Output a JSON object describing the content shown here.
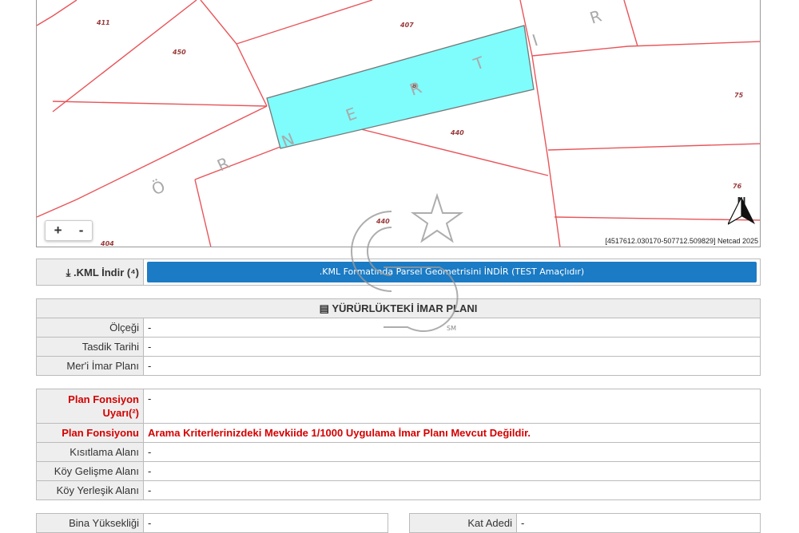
{
  "map": {
    "parcel_labels": [
      "411",
      "450",
      "407",
      "440",
      "75",
      "76",
      "440",
      "404"
    ],
    "street_letters": [
      "Ö",
      "R",
      "N",
      "E",
      "R",
      "T",
      "I",
      "R"
    ],
    "highlight_label": "8",
    "zoom_in": "+",
    "zoom_out": "-",
    "north_label": "N",
    "coordinates": "[4517612.030170-507712.509829] Netcad 2025"
  },
  "kml": {
    "label": ".KML İndir (⁴)",
    "button": ".KML Formatında Parsel Geometrisini İNDİR (TEST Amaçlıdır)"
  },
  "imar": {
    "title": "YÜRÜRLÜKTEKİ İMAR PLANI",
    "rows": [
      {
        "label": "Ölçeği",
        "value": "-"
      },
      {
        "label": "Tasdik Tarihi",
        "value": "-"
      },
      {
        "label": "Mer'i İmar Planı",
        "value": "-"
      }
    ]
  },
  "fonksiyon": {
    "uyari_label": "Plan Fonsiyon Uyarı(²)",
    "uyari_value": "-",
    "fonksiyon_label": "Plan Fonsiyonu",
    "fonksiyon_value": "Arama Kriterlerinizdeki Mevkiide 1/1000 Uygulama İmar Planı Mevcut Değildir.",
    "rows": [
      {
        "label": "Kısıtlama Alanı",
        "value": "-"
      },
      {
        "label": "Köy Gelişme Alanı",
        "value": "-"
      },
      {
        "label": "Köy Yerleşik Alanı",
        "value": "-"
      }
    ]
  },
  "bottom": {
    "left_label": "Bina Yüksekliği",
    "left_value": "-",
    "right_label": "Kat Adedi",
    "right_value": "-"
  },
  "watermark": {
    "text": "GB",
    "small": "SM"
  },
  "colors": {
    "parcel_line": "#e8555a",
    "highlight": "#7ffcfc",
    "button": "#1b7bc4",
    "warning": "#d40000"
  }
}
